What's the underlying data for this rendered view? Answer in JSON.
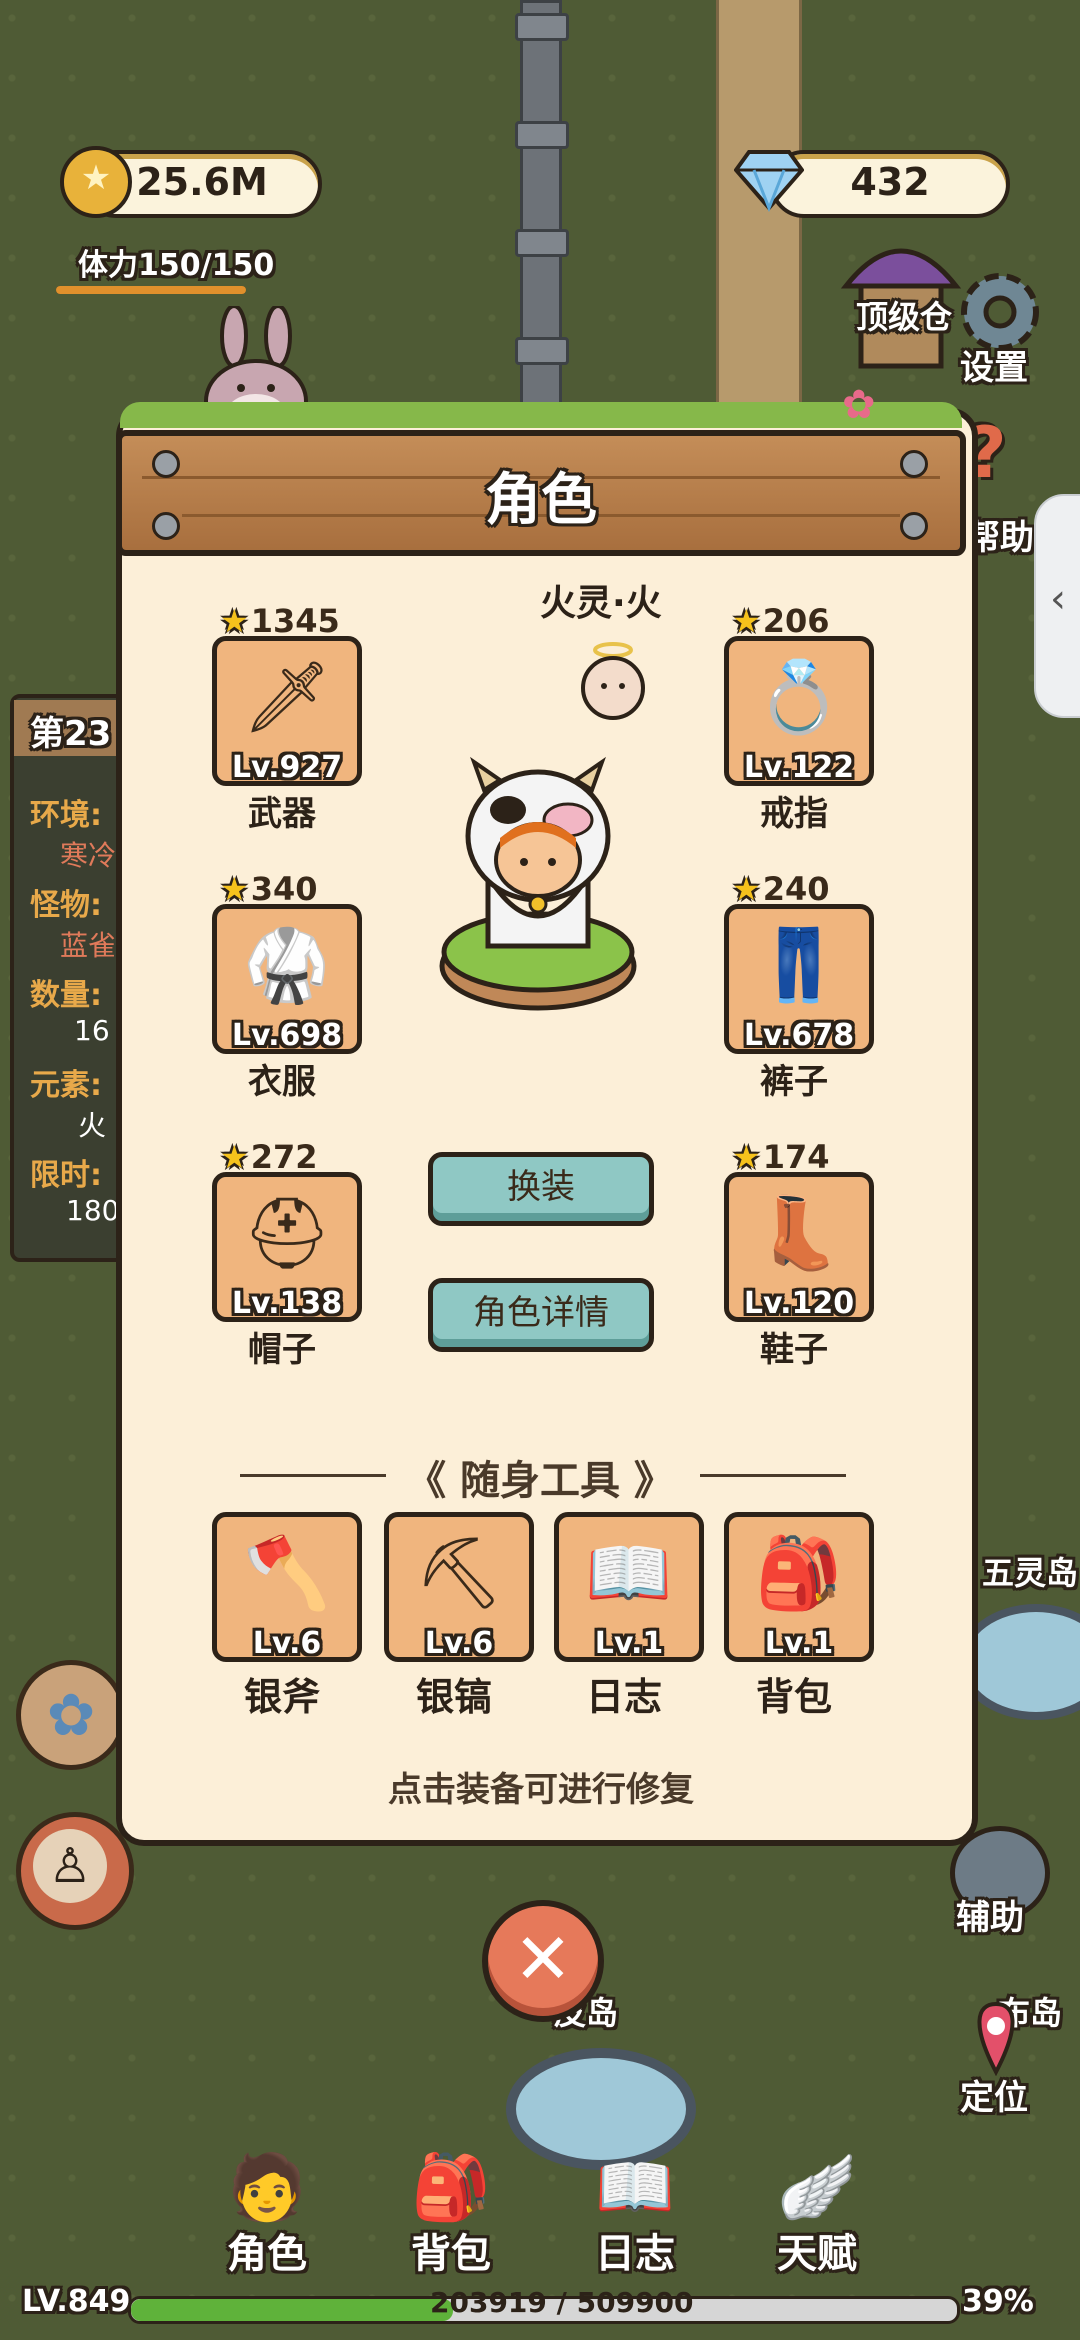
{
  "hud": {
    "coins": "25.6M",
    "gems": "432",
    "stamina": "体力150/150",
    "stamina_fraction": 1.0
  },
  "side": {
    "settings": "设置",
    "help": "帮助",
    "assist": "辅助",
    "locate": "定位",
    "top_building": "顶级仓",
    "wuling": "五灵岛",
    "pibao": "皮岛",
    "shibu": "布岛",
    "stage_partial": "第23",
    "info_partial": [
      {
        "k": "环境:",
        "v": "寒冷"
      },
      {
        "k": "怪物:",
        "v": "蓝雀"
      },
      {
        "k": "数量:",
        "v": "16"
      },
      {
        "k": "元素:",
        "v": "火"
      },
      {
        "k": "限时:",
        "v": "180"
      }
    ]
  },
  "dialog": {
    "title": "角色",
    "pet_name": "火灵·火",
    "equipment": [
      {
        "stars": "1345",
        "level": "Lv.927",
        "label": "武器",
        "icon": "sword-icon"
      },
      {
        "stars": "206",
        "level": "Lv.122",
        "label": "戒指",
        "icon": "ring-icon"
      },
      {
        "stars": "340",
        "level": "Lv.698",
        "label": "衣服",
        "icon": "armor-icon"
      },
      {
        "stars": "240",
        "level": "Lv.678",
        "label": "裤子",
        "icon": "pants-icon"
      },
      {
        "stars": "272",
        "level": "Lv.138",
        "label": "帽子",
        "icon": "helmet-icon"
      },
      {
        "stars": "174",
        "level": "Lv.120",
        "label": "鞋子",
        "icon": "boot-icon"
      }
    ],
    "swap_button": "换装",
    "detail_button": "角色详情",
    "tools_title": "随身工具",
    "tools": [
      {
        "level": "Lv.6",
        "label": "银斧",
        "icon": "axe-icon"
      },
      {
        "level": "Lv.6",
        "label": "银镐",
        "icon": "pickaxe-icon"
      },
      {
        "level": "Lv.1",
        "label": "日志",
        "icon": "book-icon"
      },
      {
        "level": "Lv.1",
        "label": "背包",
        "icon": "backpack-icon"
      }
    ],
    "hint": "点击装备可进行修复"
  },
  "nav": {
    "items": [
      {
        "label": "角色",
        "icon": "character-icon"
      },
      {
        "label": "背包",
        "icon": "backpack-icon"
      },
      {
        "label": "日志",
        "icon": "book-icon"
      },
      {
        "label": "天赋",
        "icon": "talent-icon"
      }
    ],
    "level": "LV.849",
    "xp": "203919 / 509900",
    "xp_percent": "39%",
    "xp_fraction": 0.39
  },
  "colors": {
    "accent": "#f0b57e",
    "panel": "#fcefd8",
    "button": "#8fc8c4",
    "close": "#e6795a"
  }
}
